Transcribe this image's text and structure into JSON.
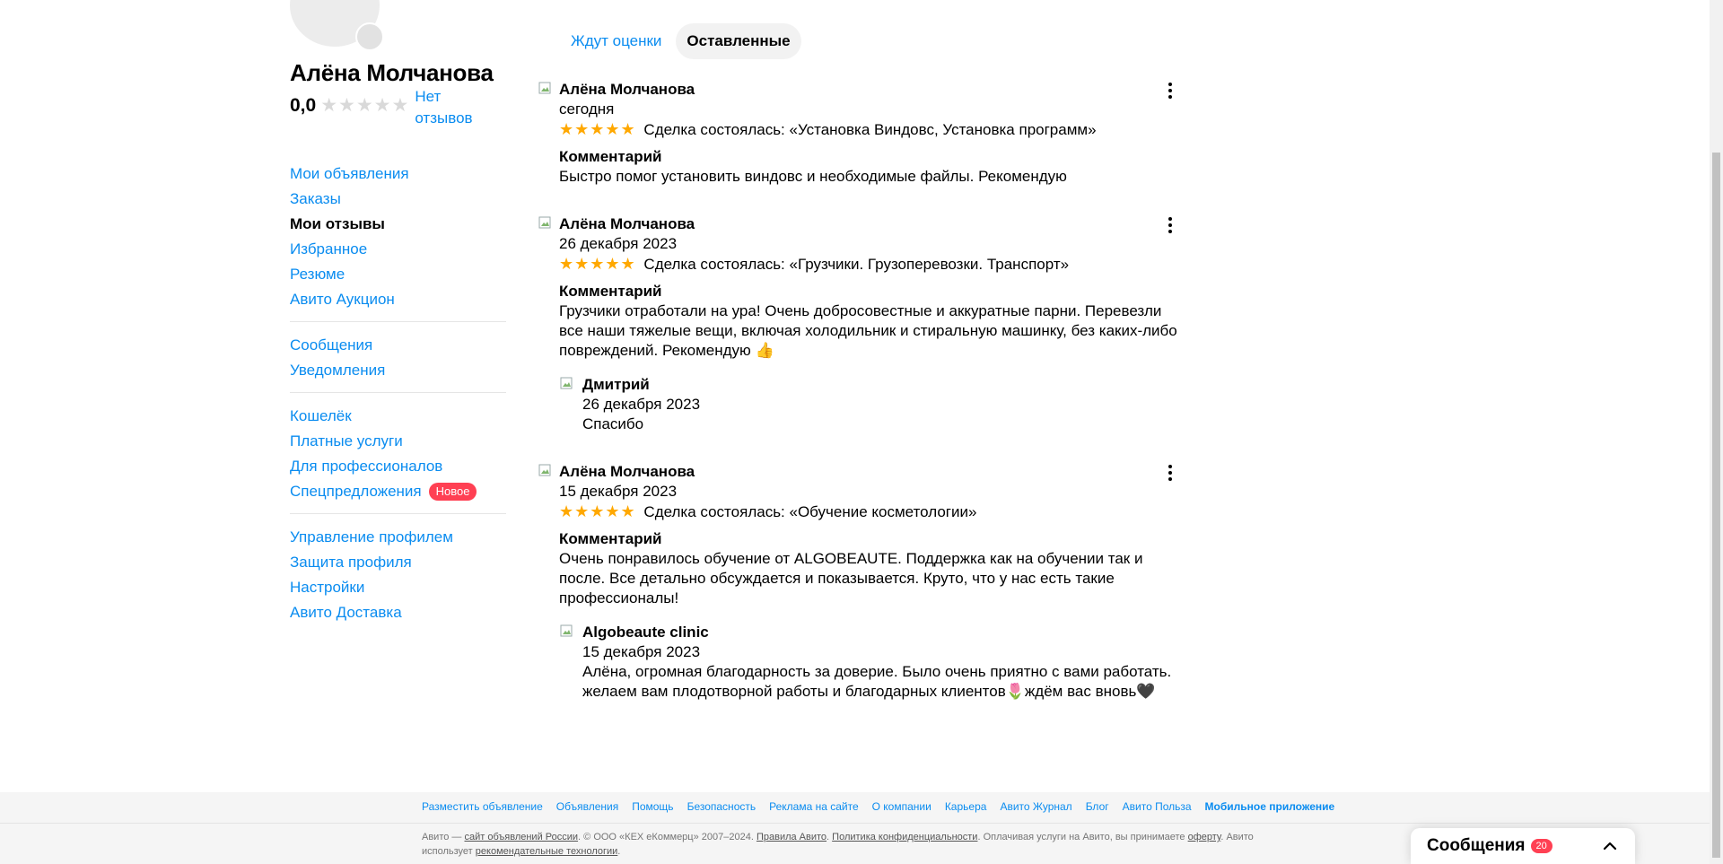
{
  "profile": {
    "name": "Алёна Молчанова",
    "rating": "0,0",
    "no_reviews": "Нет отзывов"
  },
  "sidebar": {
    "groups": [
      [
        "Мои объявления",
        "Заказы",
        "Мои отзывы",
        "Избранное",
        "Резюме",
        "Авито Аукцион"
      ],
      [
        "Сообщения",
        "Уведомления"
      ],
      [
        "Кошелёк",
        "Платные услуги",
        "Для профессионалов",
        "Спецпредложения"
      ],
      [
        "Управление профилем",
        "Защита профиля",
        "Настройки",
        "Авито Доставка"
      ]
    ],
    "active_item": "Мои отзывы",
    "badge_new": "Новое"
  },
  "tabs": {
    "awaiting": "Ждут оценки",
    "left": "Оставленные"
  },
  "reviews": [
    {
      "author": "Алёна Молчанова",
      "date": "сегодня",
      "stars": "★★★★★",
      "deal": "Сделка состоялась: «Установка Виндовс, Установка программ»",
      "comment_title": "Комментарий",
      "comment": "Быстро помог установить виндовс и необходимые файлы. Рекомендую"
    },
    {
      "author": "Алёна Молчанова",
      "date": "26 декабря 2023",
      "stars": "★★★★★",
      "deal": "Сделка состоялась: «Грузчики. Грузоперевозки. Транспорт»",
      "comment_title": "Комментарий",
      "comment": "Грузчики отработали на ура! Очень добросовестные и аккуратные парни. Перевезли все наши тяжелые вещи, включая холодильник и стиральную машинку, без каких-либо повреждений. Рекомендую 👍",
      "reply": {
        "author": "Дмитрий",
        "date": "26 декабря 2023",
        "text": "Спасибо"
      }
    },
    {
      "author": "Алёна Молчанова",
      "date": "15 декабря 2023",
      "stars": "★★★★★",
      "deal": "Сделка состоялась: «Обучение косметологии»",
      "comment_title": "Комментарий",
      "comment": "Очень понравилось обучение от ALGOBEAUTE. Поддержка как на обучении так и после. Все детально обсуждается и показывается. Круто, что у нас есть такие профессионалы!",
      "reply": {
        "author": "Algobeaute clinic",
        "date": "15 декабря 2023",
        "text": "Алёна, огромная благодарность за доверие. Было очень приятно с вами работать. желаем вам плодотворной работы и благодарных клиентов🌷ждём вас вновь🖤"
      }
    }
  ],
  "footer": {
    "links": [
      "Разместить объявление",
      "Объявления",
      "Помощь",
      "Безопасность",
      "Реклама на сайте",
      "О компании",
      "Карьера",
      "Авито Журнал",
      "Блог",
      "Авито Польза",
      "Мобильное приложение"
    ],
    "copy_1": "Авито — ",
    "copy_link_1": "сайт объявлений России",
    "copy_2": ". © ООО «КЕХ еКоммерц» 2007–2024. ",
    "copy_link_2": "Правила Авито",
    "copy_3": ". ",
    "copy_link_3": "Политика конфиденциальности",
    "copy_4": ". Оплачивая услуги на Авито, вы принимаете ",
    "copy_link_4": "оферту",
    "copy_5": ". Авито использует ",
    "copy_link_5": "рекомендательные технологии",
    "copy_6": "."
  },
  "messages_widget": {
    "title": "Сообщения",
    "count": "20"
  },
  "colors": {
    "link": "#0a8cf0",
    "star": "#ffa800",
    "badge": "#ff4053"
  }
}
